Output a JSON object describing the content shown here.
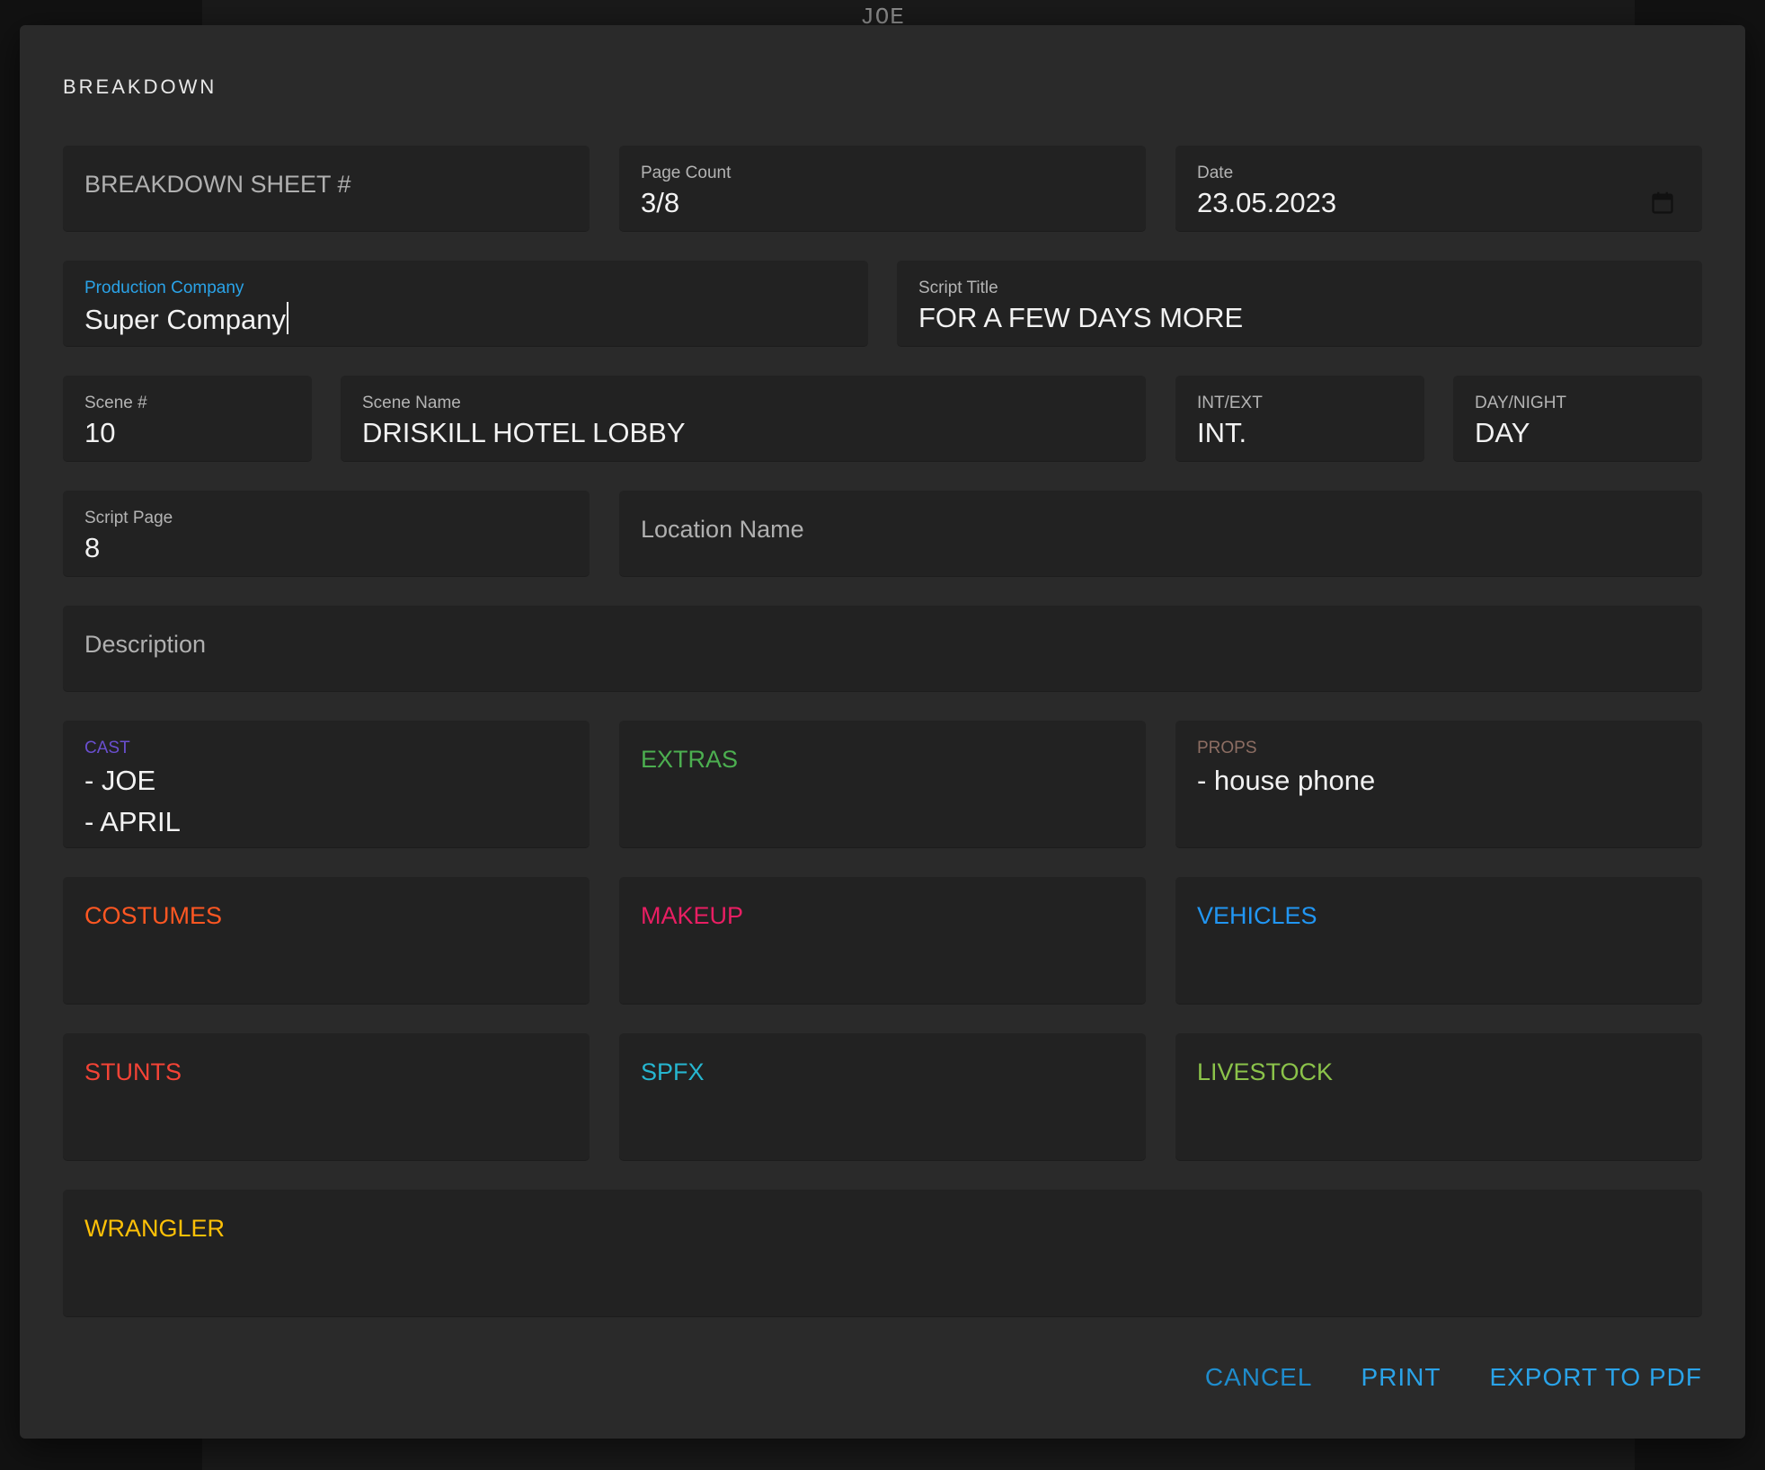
{
  "background": {
    "title": "JOE"
  },
  "dialog": {
    "title": "BREAKDOWN",
    "breakdown_sheet": {
      "placeholder": "BREAKDOWN SHEET #"
    },
    "page_count": {
      "label": "Page Count",
      "value": "3/8"
    },
    "date": {
      "label": "Date",
      "value": "23.05.2023",
      "icon": "calendar-icon"
    },
    "production_company": {
      "label": "Production Company",
      "value": "Super Company"
    },
    "script_title": {
      "label": "Script Title",
      "value": "FOR A FEW DAYS MORE"
    },
    "scene_number": {
      "label": "Scene #",
      "value": "10"
    },
    "scene_name": {
      "label": "Scene Name",
      "value": "DRISKILL HOTEL LOBBY"
    },
    "int_ext": {
      "label": "INT/EXT",
      "value": "INT."
    },
    "day_night": {
      "label": "DAY/NIGHT",
      "value": "DAY"
    },
    "script_page": {
      "label": "Script Page",
      "value": "8"
    },
    "location_name": {
      "placeholder": "Location Name"
    },
    "description": {
      "placeholder": "Description"
    },
    "cast": {
      "label": "CAST",
      "color": "#6a4fd0",
      "items": [
        "- JOE",
        "- APRIL"
      ]
    },
    "extras": {
      "label": "EXTRAS",
      "color": "#4caf50"
    },
    "props": {
      "label": "PROPS",
      "color": "#8d6e63",
      "items": [
        "- house phone"
      ]
    },
    "costumes": {
      "label": "COSTUMES",
      "color": "#ff5722"
    },
    "makeup": {
      "label": "MAKEUP",
      "color": "#e91e63"
    },
    "vehicles": {
      "label": "VEHICLES",
      "color": "#2196f3"
    },
    "stunts": {
      "label": "STUNTS",
      "color": "#f44336"
    },
    "spfx": {
      "label": "SPFX",
      "color": "#26b6d0"
    },
    "livestock": {
      "label": "LIVESTOCK",
      "color": "#8bc34a"
    },
    "wrangler": {
      "label": "WRANGLER",
      "color": "#ffc107"
    },
    "actions": {
      "cancel": "CANCEL",
      "print": "PRINT",
      "export": "EXPORT TO PDF"
    },
    "accent_color": "#2aa3e8"
  }
}
